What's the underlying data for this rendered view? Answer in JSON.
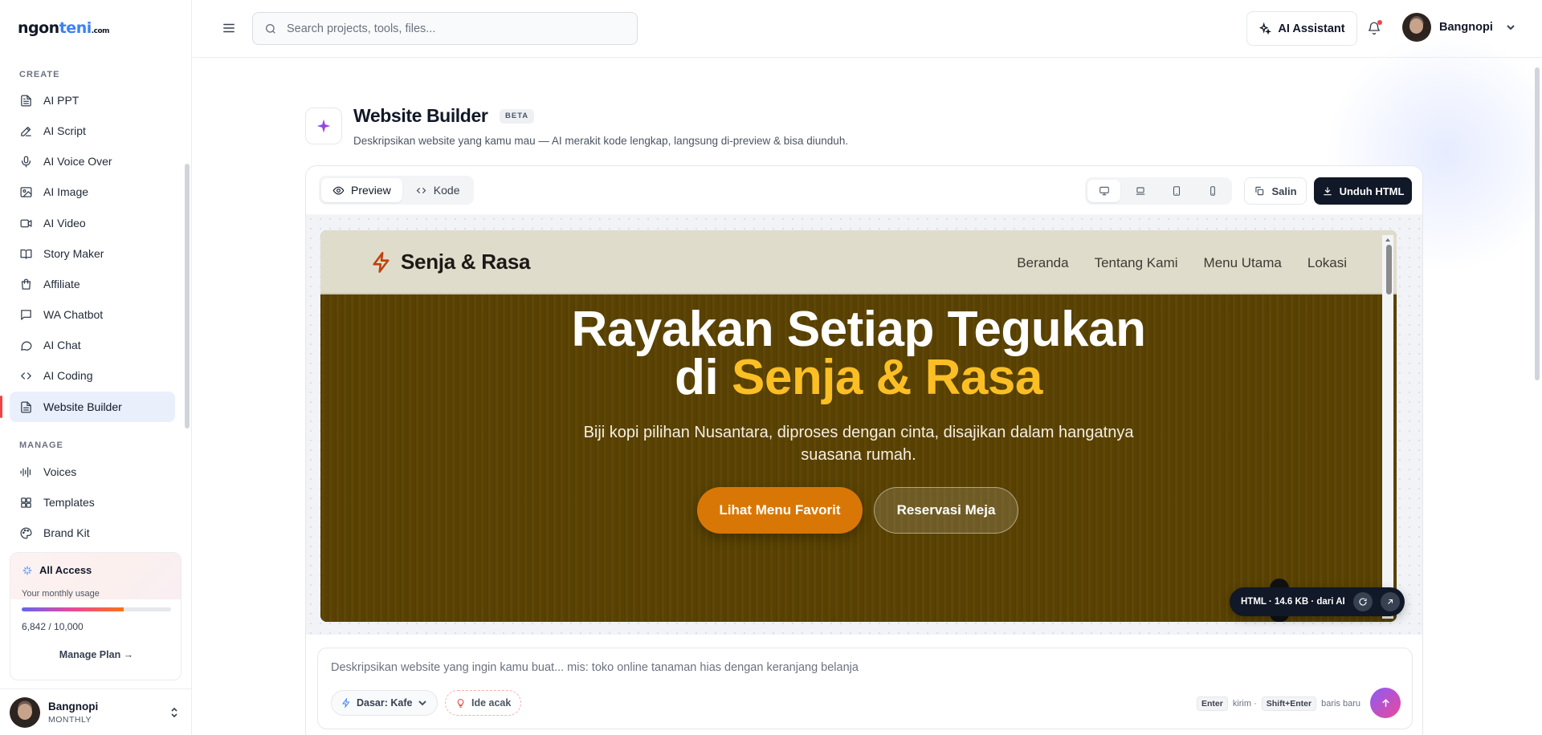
{
  "brand": {
    "logo_a": "ngon",
    "logo_b": "teni",
    "logo_c": ".com"
  },
  "sidebar": {
    "create_label": "CREATE",
    "create_items": [
      {
        "label": "AI PPT",
        "icon": "file-text-icon"
      },
      {
        "label": "AI Script",
        "icon": "pen-icon"
      },
      {
        "label": "AI Voice Over",
        "icon": "mic-icon"
      },
      {
        "label": "AI Image",
        "icon": "image-icon"
      },
      {
        "label": "AI Video",
        "icon": "video-icon"
      },
      {
        "label": "Story Maker",
        "icon": "book-icon"
      },
      {
        "label": "Affiliate",
        "icon": "bag-icon"
      },
      {
        "label": "WA Chatbot",
        "icon": "chat-square-icon"
      },
      {
        "label": "AI Chat",
        "icon": "chat-bubble-icon"
      },
      {
        "label": "AI Coding",
        "icon": "code-icon"
      },
      {
        "label": "Website Builder",
        "icon": "file-text-icon",
        "active": true
      }
    ],
    "manage_label": "MANAGE",
    "manage_items": [
      {
        "label": "Voices",
        "icon": "waveform-icon"
      },
      {
        "label": "Templates",
        "icon": "grid-icon"
      },
      {
        "label": "Brand Kit",
        "icon": "palette-icon"
      }
    ],
    "plan": {
      "title": "All Access",
      "subtitle": "Your monthly usage",
      "usage_text": "6,842 / 10,000",
      "usage_fraction": 0.6842,
      "manage_link": "Manage Plan →"
    },
    "user": {
      "name": "Bangnopi",
      "plan": "MONTHLY"
    }
  },
  "topbar": {
    "search_placeholder": "Search projects, tools, files...",
    "ai_assistant_label": "AI Assistant",
    "user_name": "Bangnopi"
  },
  "page": {
    "title": "Website Builder",
    "badge": "BETA",
    "subtitle": "Deskripsikan website yang kamu mau — AI merakit kode lengkap, langsung di-preview & bisa diunduh."
  },
  "editor": {
    "tabs": [
      {
        "label": "Preview",
        "active": true
      },
      {
        "label": "Kode",
        "active": false
      }
    ],
    "devices": [
      "desktop",
      "laptop",
      "tablet",
      "mobile"
    ],
    "active_device": "desktop",
    "copy_label": "Salin",
    "download_label": "Unduh HTML",
    "status_pill": "HTML · 14.6 KB · dari AI"
  },
  "preview_site": {
    "brand": "Senja & Rasa",
    "nav": [
      "Beranda",
      "Tentang Kami",
      "Menu Utama",
      "Lokasi"
    ],
    "headline_line1": "Rayakan Setiap Tegukan",
    "headline_di": "di",
    "headline_highlight": "Senja & Rasa",
    "tagline": "Biji kopi pilihan Nusantara, diproses dengan cinta, disajikan dalam hangatnya suasana rumah.",
    "cta_primary": "Lihat Menu Favorit",
    "cta_secondary": "Reservasi Meja",
    "colors": {
      "nav_bg": "#e0dccb",
      "hero_bg": "#5b4302",
      "accent": "#d97706",
      "highlight": "#fbbf24"
    }
  },
  "prompt": {
    "placeholder": "Deskripsikan website yang ingin kamu buat... mis: toko online tanaman hias dengan keranjang belanja",
    "base_chip": "Dasar: Kafe",
    "idea_chip": "Ide acak",
    "enter_key": "Enter",
    "enter_hint": "kirim ·",
    "shift_key": "Shift+Enter",
    "shift_hint": "baris baru"
  }
}
